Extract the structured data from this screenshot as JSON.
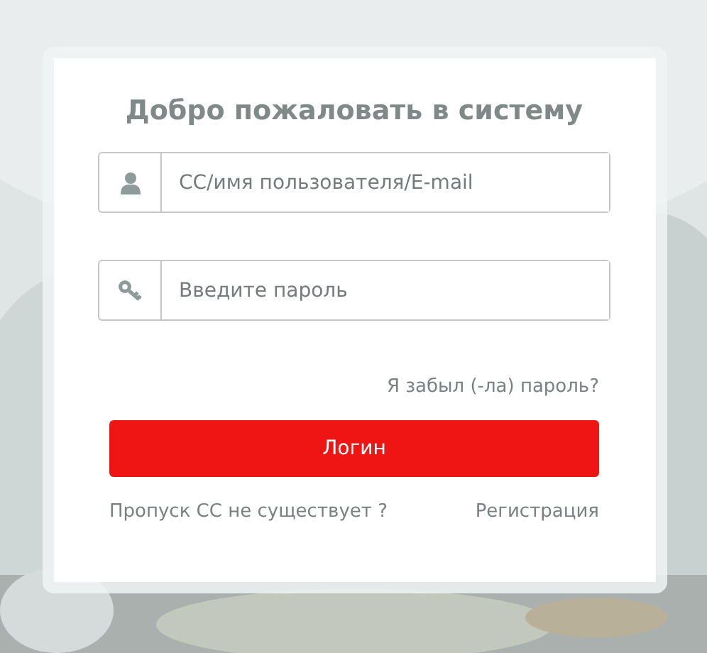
{
  "title": "Добро пожаловать в систему",
  "fields": [
    {
      "kind": "user",
      "placeholder": "СС/имя пользователя/E-mail"
    },
    {
      "kind": "password",
      "placeholder": "Введите пароль"
    }
  ],
  "forgot_link": "Я забыл (-ла) пароль?",
  "login_button": "Логин",
  "footer_links": [
    "Пропуск СС не существует ?",
    "Регистрация"
  ]
}
